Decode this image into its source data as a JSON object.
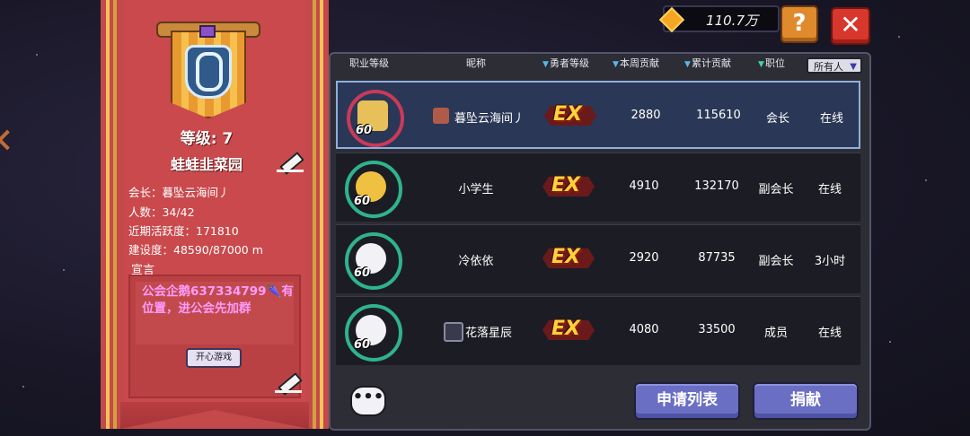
{
  "topbar": {
    "currency_value": "110.7万",
    "help_label": "?",
    "close_label": "✕"
  },
  "guild": {
    "level": "等级: 7",
    "name": "蛙蛙韭菜园",
    "leader": "会长：暮坠云海间丿",
    "members": "人数：34/42",
    "activity": "近期活跃度：171810",
    "construction": "建设度：48590/87000 m",
    "declaration_label": "宣言",
    "declaration_text": "公会企鹅637334799🌂有位置，进公会先加群",
    "play_button": "开心游戏"
  },
  "table": {
    "headers": {
      "class_level": "职业等级",
      "nickname": "昵称",
      "hero_level": "勇者等级",
      "weekly": "本周贡献",
      "total": "累计贡献",
      "position": "职位"
    },
    "filter": "所有人",
    "rows": [
      {
        "level": "60",
        "nickname": "暮坠云海间丿",
        "rank": "EX",
        "weekly": "2880",
        "total": "115610",
        "position": "会长",
        "status": "在线"
      },
      {
        "level": "60",
        "nickname": "小学生",
        "rank": "EX",
        "weekly": "4910",
        "total": "132170",
        "position": "副会长",
        "status": "在线"
      },
      {
        "level": "60",
        "nickname": "冷依依",
        "rank": "EX",
        "weekly": "2920",
        "total": "87735",
        "position": "副会长",
        "status": "3小时"
      },
      {
        "level": "60",
        "nickname": "花落星辰",
        "rank": "EX",
        "weekly": "4080",
        "total": "33500",
        "position": "成员",
        "status": "在线"
      }
    ]
  },
  "footer": {
    "chat_icon": "•••",
    "apply_list": "申请列表",
    "donate": "捐献"
  }
}
